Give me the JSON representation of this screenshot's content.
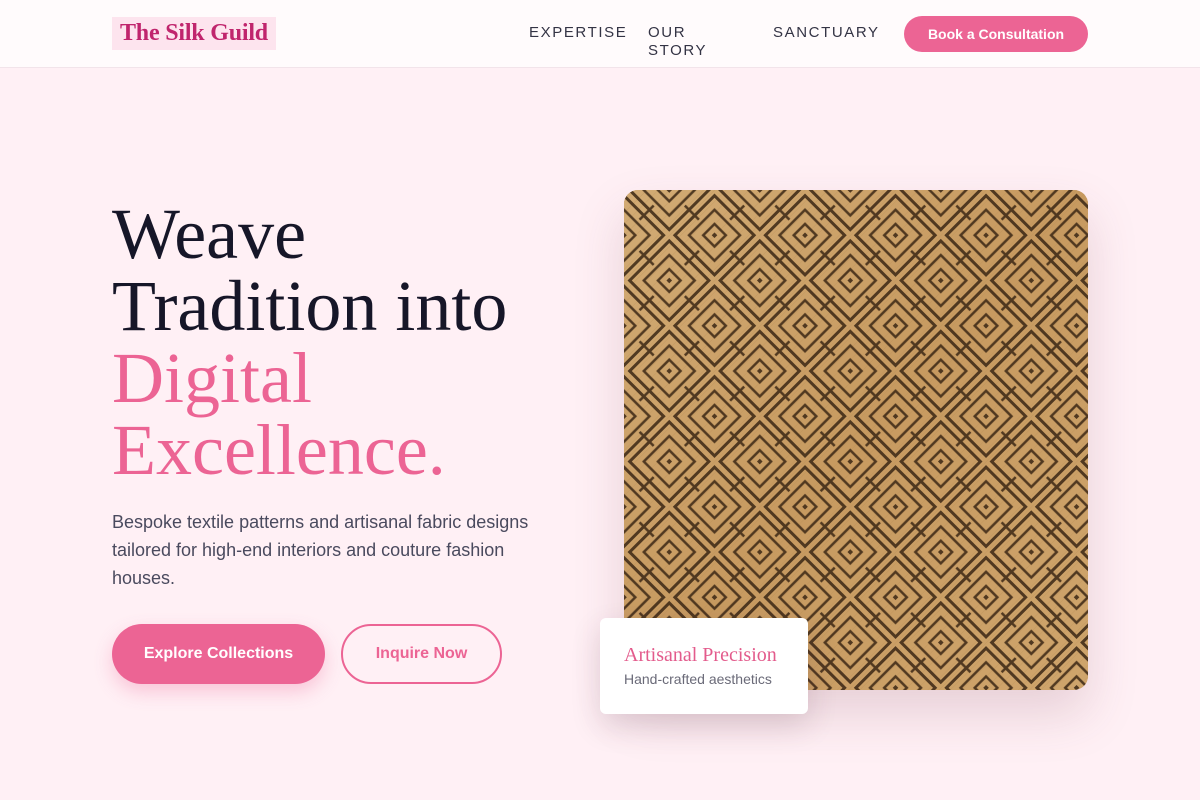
{
  "header": {
    "logo": "The Silk Guild",
    "nav": [
      "EXPERTISE",
      "OUR STORY",
      "SANCTUARY"
    ],
    "cta_label": "Book a Consultation"
  },
  "hero": {
    "headline_line1": "Weave",
    "headline_line2": "Tradition into",
    "headline_line3": "Digital",
    "headline_line4": "Excellence.",
    "description": "Bespoke textile patterns and artisanal fabric designs tailored for high-end interiors and couture fashion houses.",
    "primary_button": "Explore Collections",
    "secondary_button": "Inquire Now"
  },
  "feature_card": {
    "title": "Artisanal Precision",
    "subtitle": "Hand-crafted aesthetics"
  },
  "colors": {
    "accent": "#ec6494",
    "logo": "#c0256d",
    "background": "#fff0f5",
    "heading": "#161628",
    "fabric_base": "#c9a06a",
    "fabric_ink": "#3a2614"
  }
}
